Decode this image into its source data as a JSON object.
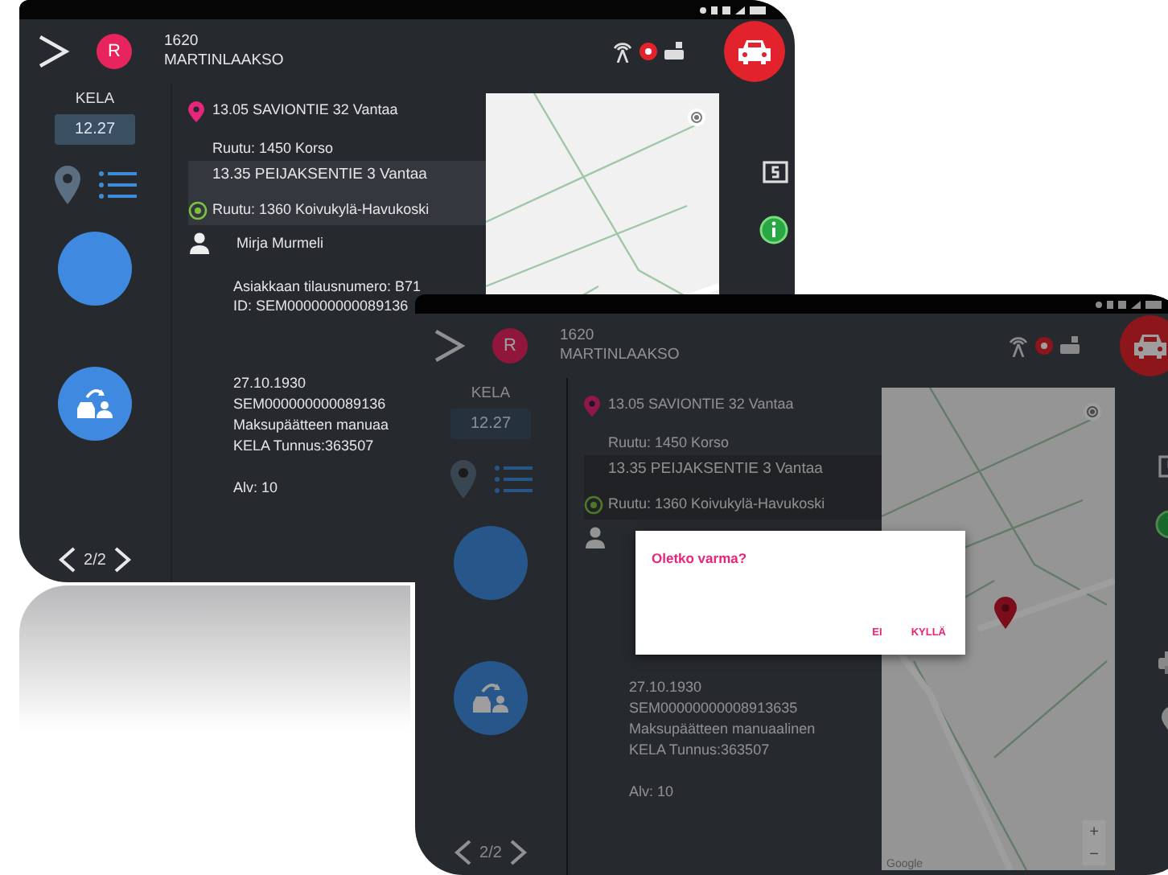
{
  "screens": [
    {
      "dimmed": false,
      "header": {
        "avatar": "R",
        "vehicle": "1620",
        "area": "MARTINLAAKSO"
      },
      "sidebar": {
        "label": "KELA",
        "time": "12.27",
        "pager": "2/2"
      },
      "stops": [
        {
          "kind": "pickup",
          "address": "13.05 SAVIONTIE 32 Vantaa",
          "zone": "Ruutu: 1450 Korso",
          "highlighted": false
        },
        {
          "kind": "dropoff",
          "address": "13.35 PEIJAKSENTIE 3 Vantaa",
          "zone": "Ruutu: 1360 Koivukylä-Havukoski",
          "highlighted": true
        }
      ],
      "passenger": {
        "name": "Mirja Murmeli"
      },
      "order_lines": [
        "Asiakkaan tilausnumero: B71",
        "ID: SEM000000000089136"
      ],
      "details": [
        "27.10.1930",
        "SEM000000000089136",
        "Maksupäätteen manuaa",
        "KELA Tunnus:363507"
      ],
      "vat": "Alv: 10",
      "right_actions": [
        {
          "kind": "payment"
        },
        {
          "kind": "info"
        }
      ]
    },
    {
      "dimmed": true,
      "header": {
        "avatar": "R",
        "vehicle": "1620",
        "area": "MARTINLAAKSO"
      },
      "sidebar": {
        "label": "KELA",
        "time": "12.27",
        "pager": "2/2"
      },
      "stops": [
        {
          "kind": "pickup",
          "address": "13.05 SAVIONTIE 32 Vantaa",
          "zone": "Ruutu: 1450 Korso",
          "highlighted": false
        },
        {
          "kind": "dropoff",
          "address": "13.35 PEIJAKSENTIE 3 Vantaa",
          "zone": "Ruutu: 1360 Koivukylä-Havukoski",
          "highlighted": true
        }
      ],
      "details": [
        "27.10.1930",
        "SEM00000000008913635",
        "Maksupäätteen manuaalinen",
        "KELA Tunnus:363507"
      ],
      "vat": "Alv: 10",
      "map": {
        "marker": true,
        "zoom_in": "+",
        "zoom_out": "−",
        "attribution": "Google"
      },
      "right_actions": [
        {
          "kind": "payment"
        },
        {
          "kind": "info"
        },
        {
          "kind": "printer"
        },
        {
          "kind": "location"
        }
      ],
      "dialog": {
        "title": "Oletko varma?",
        "buttons": [
          "EI",
          "KYLLÄ"
        ]
      }
    }
  ]
}
